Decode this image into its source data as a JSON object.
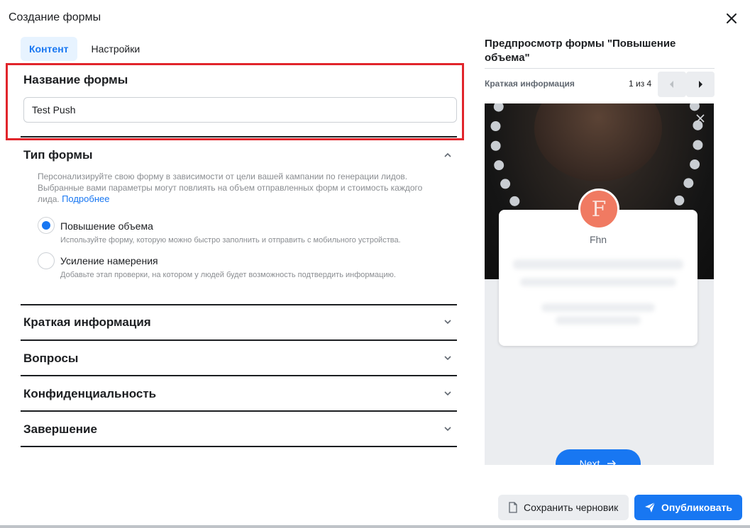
{
  "dialog": {
    "title": "Создание формы"
  },
  "tabs": [
    {
      "label": "Контент",
      "active": true
    },
    {
      "label": "Настройки",
      "active": false
    }
  ],
  "form_name": {
    "label": "Название формы",
    "value": "Test Push"
  },
  "form_type": {
    "title": "Тип формы",
    "description": "Персонализируйте свою форму в зависимости от цели вашей кампании по генерации лидов. Выбранные вами параметры могут повлиять на объем отправленных форм и стоимость каждого лида.",
    "link": "Подробнее",
    "options": [
      {
        "label": "Повышение объема",
        "description": "Используйте форму, которую можно быстро заполнить и отправить с мобильного устройства.",
        "selected": true
      },
      {
        "label": "Усиление намерения",
        "description": "Добавьте этап проверки, на котором у людей будет возможность подтвердить информацию.",
        "selected": false
      }
    ]
  },
  "sections": [
    {
      "label": "Краткая информация"
    },
    {
      "label": "Вопросы"
    },
    {
      "label": "Конфиденциальность"
    },
    {
      "label": "Завершение"
    }
  ],
  "preview": {
    "title": "Предпросмотр формы \"Повышение объема\"",
    "section": "Краткая информация",
    "counter": "1 из 4",
    "page_name": "Fhn",
    "avatar_letter": "F",
    "next_label": "Next"
  },
  "footer": {
    "draft_label": "Сохранить черновик",
    "publish_label": "Опубликовать"
  },
  "colors": {
    "accent": "#1877f2",
    "highlight_box": "#e1252b",
    "avatar_bg": "#f07a62"
  }
}
